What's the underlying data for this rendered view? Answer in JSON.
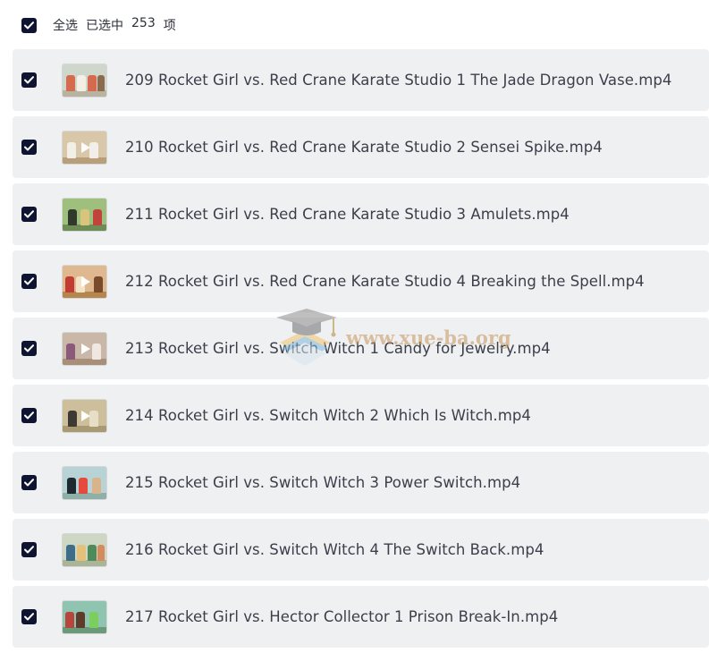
{
  "header": {
    "select_all_label": "全选",
    "selected_prefix": "已选中",
    "selected_count": "253",
    "selected_suffix": "项",
    "checked": true
  },
  "files": [
    {
      "name": "209 Rocket Girl vs. Red Crane Karate Studio 1 The Jade Dragon Vase.mp4",
      "checked": true
    },
    {
      "name": "210 Rocket Girl vs. Red Crane Karate Studio 2 Sensei Spike.mp4",
      "checked": true
    },
    {
      "name": "211 Rocket Girl vs. Red Crane Karate Studio 3 Amulets.mp4",
      "checked": true
    },
    {
      "name": "212 Rocket Girl vs. Red Crane Karate Studio 4 Breaking the Spell.mp4",
      "checked": true
    },
    {
      "name": "213 Rocket Girl vs. Switch Witch 1 Candy for Jewelry.mp4",
      "checked": true
    },
    {
      "name": "214 Rocket Girl vs. Switch Witch 2 Which Is Witch.mp4",
      "checked": true
    },
    {
      "name": "215 Rocket Girl vs. Switch Witch 3 Power Switch.mp4",
      "checked": true
    },
    {
      "name": "216 Rocket Girl vs. Switch Witch 4 The Switch Back.mp4",
      "checked": true
    },
    {
      "name": "217 Rocket Girl vs. Hector Collector 1 Prison Break-In.mp4",
      "checked": true
    }
  ],
  "watermark": {
    "text": "www.xue-ba.org",
    "icon": "graduation-cap-books-icon"
  },
  "colors": {
    "checkbox": "#0f1430",
    "row_background": "#eff0f2",
    "text": "#3b3f4a"
  },
  "icons": {
    "checkbox": "checkbox-checked-icon",
    "thumbnail": "video-thumbnail",
    "play": "play-icon"
  }
}
